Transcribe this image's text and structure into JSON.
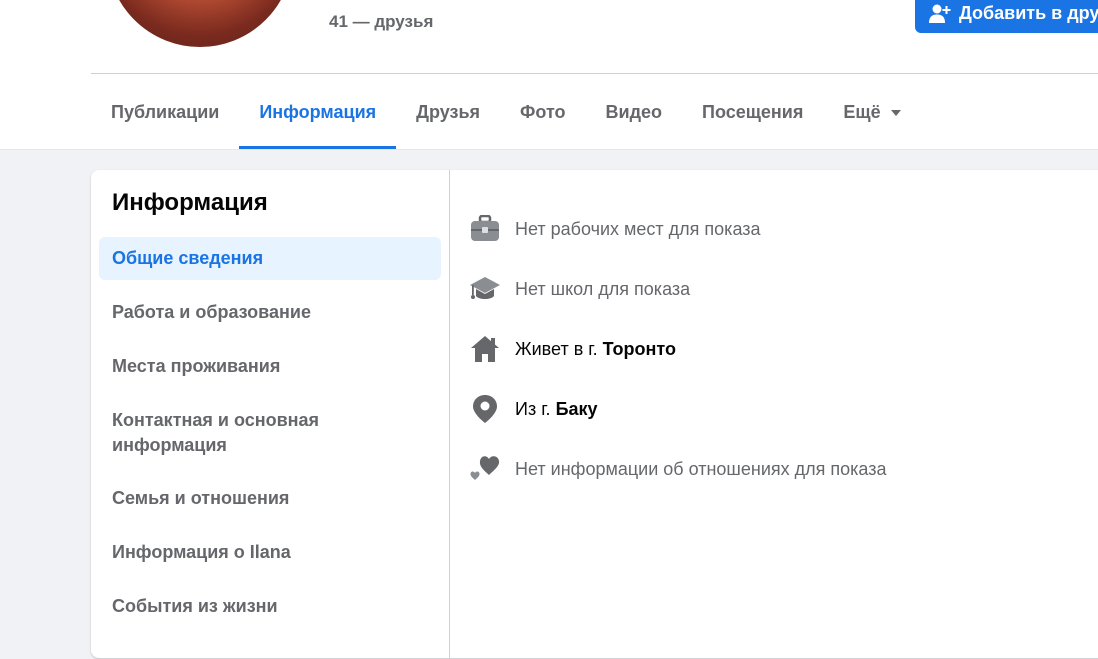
{
  "header": {
    "friends_text": "41 — друзья",
    "add_friend_label": "Добавить в друзья"
  },
  "tabs": [
    {
      "label": "Публикации"
    },
    {
      "label": "Информация"
    },
    {
      "label": "Друзья"
    },
    {
      "label": "Фото"
    },
    {
      "label": "Видео"
    },
    {
      "label": "Посещения"
    },
    {
      "label": "Ещё"
    }
  ],
  "about": {
    "title": "Информация",
    "nav": [
      {
        "label": "Общие сведения"
      },
      {
        "label": "Работа и образование"
      },
      {
        "label": "Места проживания"
      },
      {
        "label": "Контактная и основная информация"
      },
      {
        "label": "Семья и отношения"
      },
      {
        "label": "Информация о Ilana"
      },
      {
        "label": "События из жизни"
      }
    ],
    "rows": {
      "work": "Нет рабочих мест для показа",
      "school": "Нет школ для показа",
      "lives_prefix": "Живет в г. ",
      "lives_city": "Торонто",
      "from_prefix": "Из г. ",
      "from_city": "Баку",
      "relationship": "Нет информации об отношениях для показа"
    }
  },
  "icons": {
    "work": "briefcase-icon",
    "school": "graduation-cap-icon",
    "lives": "home-icon",
    "from": "location-pin-icon",
    "relationship": "hearts-icon",
    "add_friend": "person-add-icon"
  },
  "colors": {
    "accent": "#1b74e4",
    "active_nav_bg": "#e7f3ff",
    "secondary_text": "#65676b",
    "page_bg": "#f0f2f5"
  }
}
